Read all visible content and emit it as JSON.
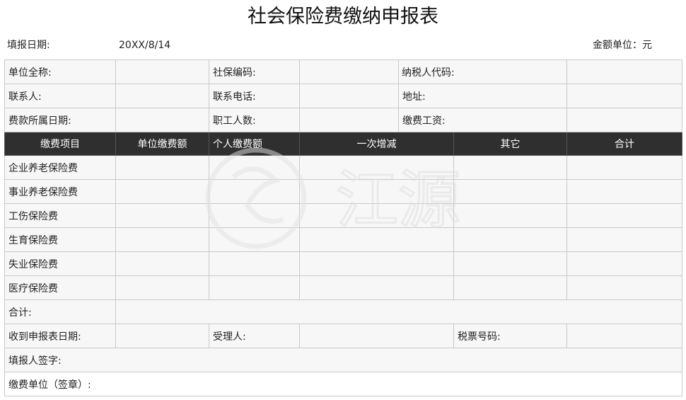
{
  "title": "社会保险费缴纳申报表",
  "fill_date_label": "填报日期:",
  "fill_date_value": "20XX/8/14",
  "amount_unit": "金额单位：元",
  "info_rows": [
    [
      "单位全称:",
      "社保编码:",
      "纳税人代码:"
    ],
    [
      "联系人:",
      "联系电话:",
      "地址:"
    ],
    [
      "费款所属日期:",
      "职工人数:",
      "缴费工资:"
    ]
  ],
  "headers": [
    "缴费项目",
    "单位缴费额",
    "个人缴费额",
    "一次增减",
    "其它",
    "合计"
  ],
  "items": [
    "企业养老保险费",
    "事业养老保险费",
    "工伤保险费",
    "生育保险费",
    "失业保险费",
    "医疗保险费"
  ],
  "total_label": "合计:",
  "received_date_label": "收到申报表日期:",
  "receiver_label": "受理人:",
  "tax_ticket_label": "税票号码:",
  "filler_sign_label": "填报人签字:",
  "unit_seal_label": "缴费单位（签章）:",
  "watermark_text": "江源",
  "colors": {
    "header_bg": "#2f2f2f",
    "header_text": "#ffffff",
    "grid": "#c9c9c9",
    "cell_bg": "#f7f7f7"
  }
}
